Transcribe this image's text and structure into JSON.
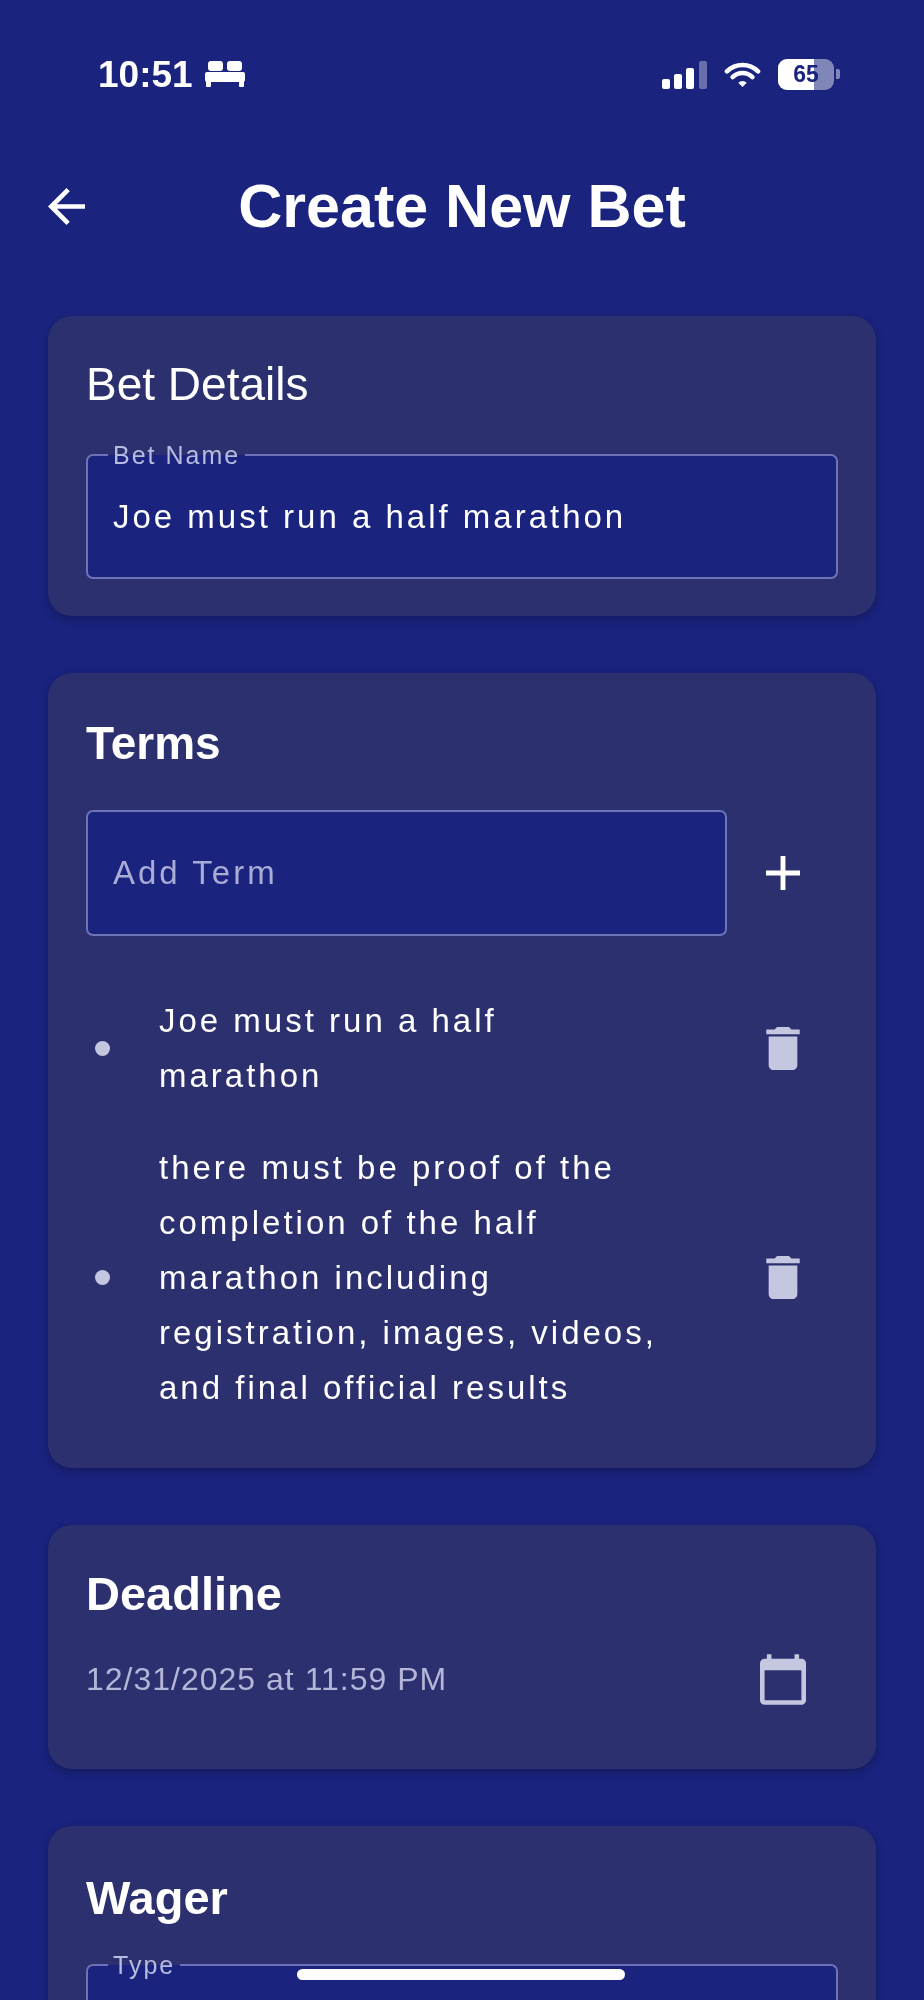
{
  "status_bar": {
    "time": "10:51",
    "battery": "65"
  },
  "header": {
    "title": "Create New Bet"
  },
  "bet_details": {
    "title": "Bet Details",
    "bet_name": {
      "label": "Bet Name",
      "value": "Joe must run a half marathon"
    }
  },
  "terms": {
    "title": "Terms",
    "add_term": {
      "placeholder": "Add Term"
    },
    "items": [
      {
        "text": "Joe must run a half marathon"
      },
      {
        "text": "there must be proof of the completion of the half marathon including registration, images, videos, and final official results"
      }
    ]
  },
  "deadline": {
    "title": "Deadline",
    "value": "12/31/2025 at 11:59 PM"
  },
  "wager": {
    "title": "Wager",
    "type": {
      "label": "Type"
    }
  }
}
